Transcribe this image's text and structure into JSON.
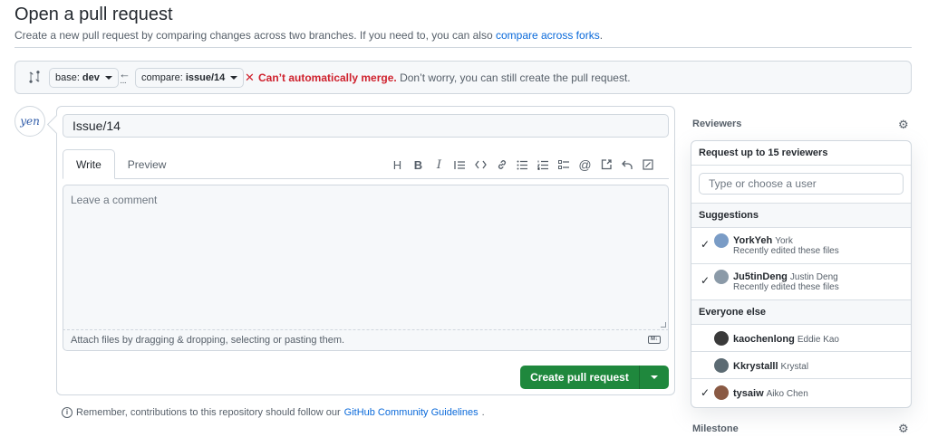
{
  "header": {
    "title": "Open a pull request",
    "subtitle": "Create a new pull request by comparing changes across two branches. If you need to, you can also",
    "subtitle_link": "compare across forks",
    "subtitle_end": "."
  },
  "range": {
    "base_prefix": "base:",
    "base_branch": "dev",
    "compare_prefix": "compare:",
    "compare_branch": "issue/14",
    "merge_status": "Can’t automatically merge.",
    "merge_hint": "Don’t worry, you can still create the pull request."
  },
  "avatar": {
    "text": "yen"
  },
  "editor": {
    "title_value": "Issue/14",
    "tabs": [
      "Write",
      "Preview"
    ],
    "toolbar_icons": [
      "heading-icon",
      "bold-icon",
      "italic-icon",
      "quote-icon",
      "code-icon",
      "link-icon",
      "unordered-list-icon",
      "ordered-list-icon",
      "task-list-icon",
      "mention-icon",
      "reference-icon",
      "reply-icon",
      "fullscreen-icon"
    ],
    "placeholder": "Leave a comment",
    "attach_text": "Attach files by dragging & dropping, selecting or pasting them.",
    "md_badge": "M↓",
    "create_label": "Create pull request"
  },
  "footnote": {
    "text": "Remember, contributions to this repository should follow our",
    "link": "GitHub Community Guidelines",
    "end": "."
  },
  "sidebar": {
    "reviewers_label": "Reviewers",
    "milestone_label": "Milestone",
    "popup": {
      "header": "Request up to 15 reviewers",
      "search_placeholder": "Type or choose a user",
      "suggestions_label": "Suggestions",
      "everyone_label": "Everyone else",
      "suggestions": [
        {
          "login": "YorkYeh",
          "name": "York",
          "sub": "Recently edited these files",
          "checked": true,
          "color": "#7a9cc6"
        },
        {
          "login": "Ju5tinDeng",
          "name": "Justin Deng",
          "sub": "Recently edited these files",
          "checked": true,
          "color": "#8b9aa8"
        }
      ],
      "others": [
        {
          "login": "kaochenlong",
          "name": "Eddie Kao",
          "checked": false,
          "color": "#3a3a3a"
        },
        {
          "login": "Kkrystalll",
          "name": "Krystal",
          "checked": false,
          "color": "#5c6b73"
        },
        {
          "login": "tysaiw",
          "name": "Aiko Chen",
          "checked": true,
          "color": "#8a5a44"
        }
      ]
    }
  },
  "colors": {
    "accent": "#0969da",
    "danger": "#cf222e",
    "primary_button": "#1f883d"
  }
}
